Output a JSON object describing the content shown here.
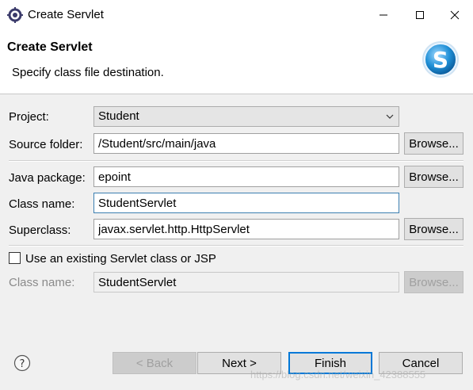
{
  "window": {
    "title": "Create Servlet",
    "icons": {
      "app": "eclipse-gear-icon",
      "minimize": "minimize-icon",
      "maximize": "maximize-icon",
      "close": "close-icon"
    }
  },
  "header": {
    "title": "Create Servlet",
    "description": "Specify class file destination.",
    "logo_icon": "servlet-s-logo-icon"
  },
  "form": {
    "project": {
      "label": "Project:",
      "value": "Student"
    },
    "source_folder": {
      "label": "Source folder:",
      "value": "/Student/src/main/java",
      "browse": "Browse..."
    },
    "java_package": {
      "label": "Java package:",
      "value": "epoint",
      "browse": "Browse..."
    },
    "class_name": {
      "label": "Class name:",
      "value": "StudentServlet"
    },
    "superclass": {
      "label": "Superclass:",
      "value": "javax.servlet.http.HttpServlet",
      "browse": "Browse..."
    },
    "use_existing": {
      "label": "Use an existing Servlet class or JSP",
      "checked": false
    },
    "existing_class_name": {
      "label": "Class name:",
      "value": "StudentServlet",
      "browse": "Browse..."
    }
  },
  "footer": {
    "help_icon": "help-icon",
    "back": "< Back",
    "next": "Next >",
    "finish": "Finish",
    "cancel": "Cancel"
  },
  "watermark": "https://blog.csdn.net/weixin_42388555",
  "colors": {
    "accent": "#0078d7",
    "focus_border": "#3c7fb1",
    "logo_blue": "#1f8fd6"
  }
}
